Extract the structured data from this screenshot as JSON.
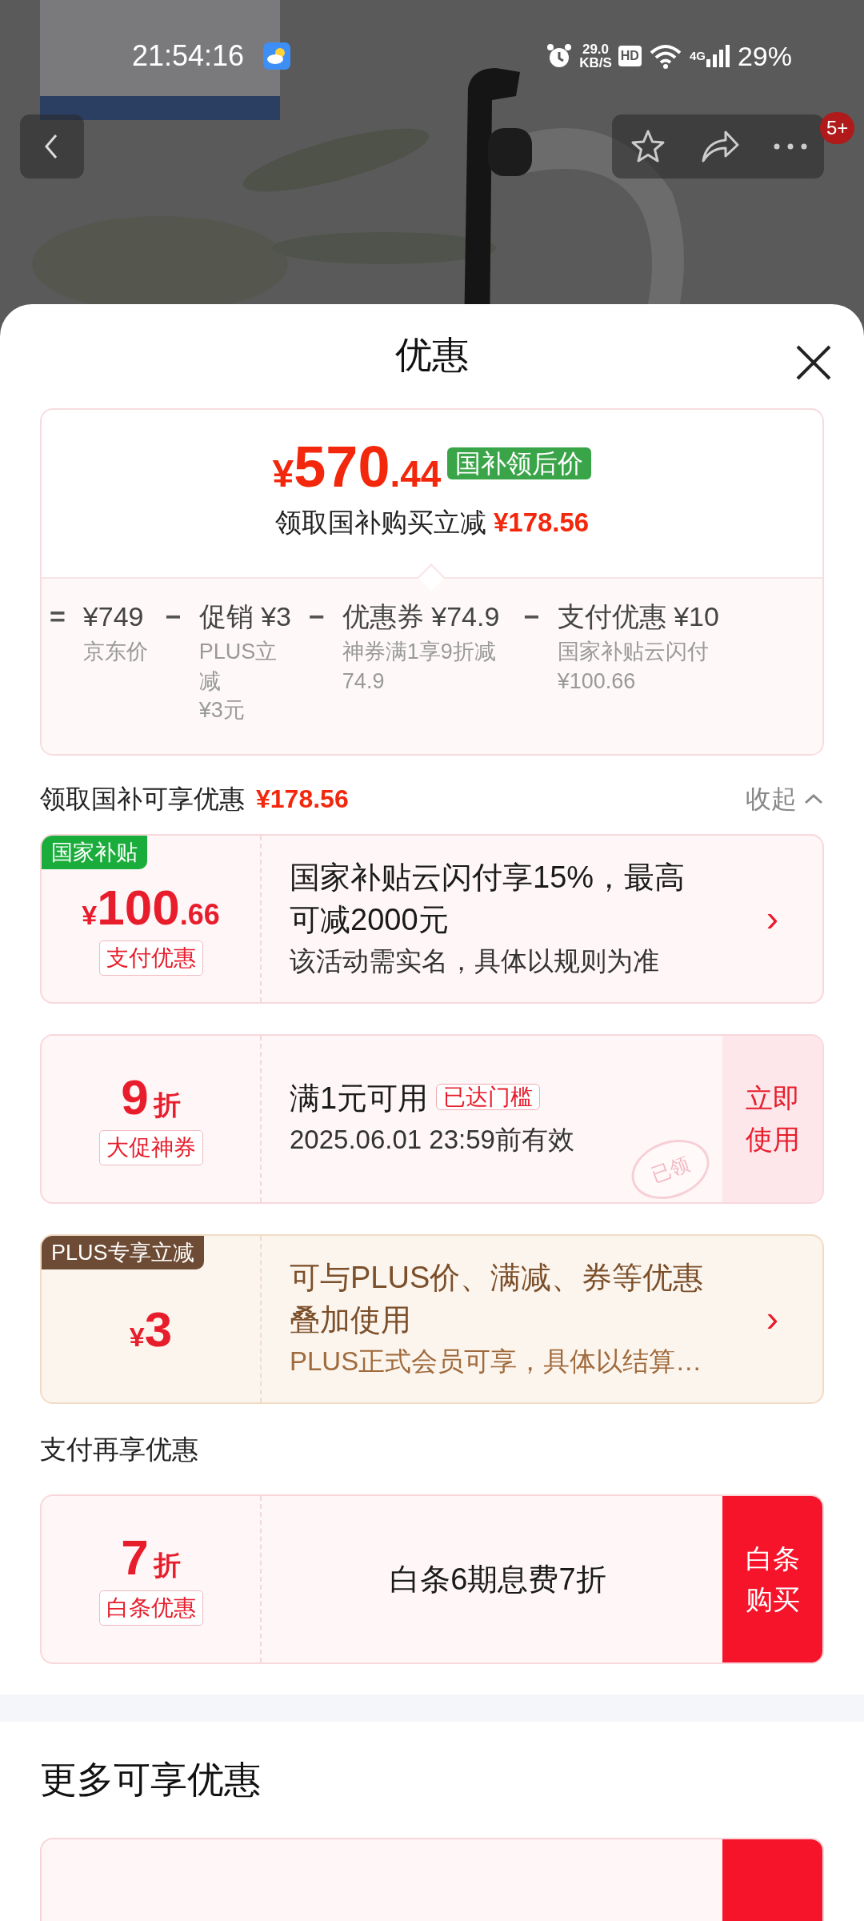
{
  "status_bar": {
    "time": "21:54:16",
    "speed": "29.0",
    "speed_unit": "KB/S",
    "hd": "HD",
    "network": "4G",
    "battery": "29%"
  },
  "nav": {
    "badge": "5+"
  },
  "sheet": {
    "title": "优惠"
  },
  "price_card": {
    "currency": "¥",
    "price_int": "570",
    "price_dec": ".44",
    "tag": "国补领后价",
    "subtitle": "领取国补购买立减",
    "saving": "¥178.56",
    "breakdown": [
      {
        "op": "=",
        "title": "¥749",
        "lines": [
          "京东价"
        ]
      },
      {
        "op": "−",
        "title": "促销 ¥3",
        "lines": [
          "PLUS立减",
          "¥3元"
        ]
      },
      {
        "op": "−",
        "title": "优惠券 ¥74.9",
        "lines": [
          "神券满1享9折减74.9"
        ]
      },
      {
        "op": "−",
        "title": "支付优惠 ¥10",
        "lines": [
          "国家补贴云闪付",
          "¥100.66"
        ]
      }
    ]
  },
  "summary": {
    "label": "领取国补可享优惠",
    "amount": "¥178.56",
    "toggle": "收起",
    "expanded": true
  },
  "sections": [
    {
      "cards": [
        {
          "kind": "red",
          "corner_tag": {
            "text": "国家补贴",
            "color": "#1aad3b"
          },
          "currency": "¥",
          "amount": "100",
          "amount_dec": ".66",
          "label": "支付优惠",
          "title": "国家补贴云闪付享15%，最高可减2000元",
          "desc": "该活动需实名，具体以规则为准",
          "action": {
            "kind": "arrow",
            "text": "›"
          }
        },
        {
          "kind": "red",
          "amount": "9",
          "unit": "折",
          "label": "大促神券",
          "title": "满1元可用",
          "badge": "已达门槛",
          "desc": "2025.06.01 23:59前有效",
          "stamp": "已领",
          "action": {
            "kind": "soft",
            "text": "立即使用"
          }
        },
        {
          "kind": "gold",
          "corner_tag": {
            "text": "PLUS专享立减",
            "color": "#6e4b34"
          },
          "currency": "¥",
          "amount": "3",
          "title": "可与PLUS价、满减、券等优惠叠加使用",
          "desc": "PLUS正式会员可享，具体以结算…",
          "action": {
            "kind": "arrow",
            "text": "›"
          }
        }
      ]
    },
    {
      "heading": "支付再享优惠",
      "cards": [
        {
          "kind": "red",
          "amount": "7",
          "unit": "折",
          "label": "白条优惠",
          "title": "白条6期息费7折",
          "action": {
            "kind": "solid",
            "text": "白条购买"
          }
        }
      ]
    }
  ],
  "more": {
    "heading": "更多可享优惠"
  }
}
